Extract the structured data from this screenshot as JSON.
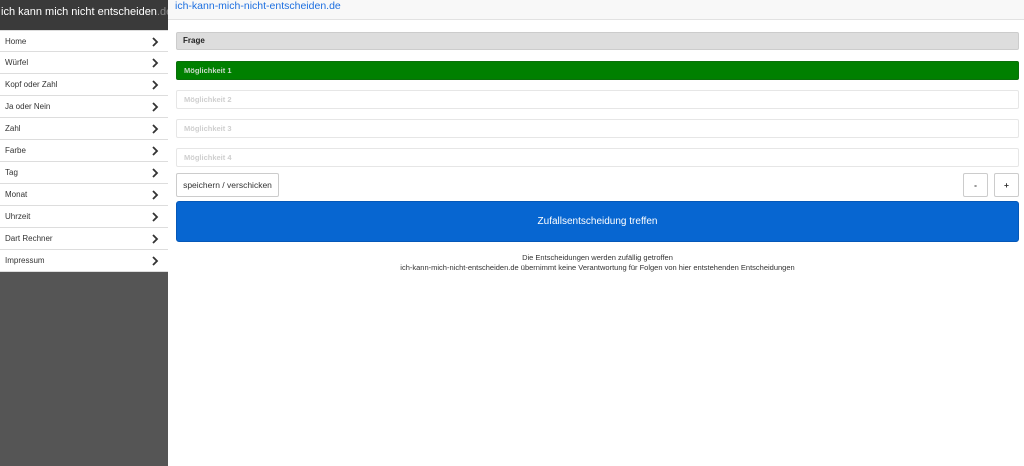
{
  "brand": {
    "name": "ich kann mich nicht entscheiden",
    "tld": ".de"
  },
  "topbar": {
    "site_link": "ich-kann-mich-nicht-entscheiden.de"
  },
  "sidebar": {
    "items": [
      {
        "label": "Home"
      },
      {
        "label": "Würfel"
      },
      {
        "label": "Kopf oder Zahl"
      },
      {
        "label": "Ja oder Nein"
      },
      {
        "label": "Zahl"
      },
      {
        "label": "Farbe"
      },
      {
        "label": "Tag"
      },
      {
        "label": "Monat"
      },
      {
        "label": "Uhrzeit"
      },
      {
        "label": "Dart Rechner"
      },
      {
        "label": "Impressum"
      }
    ]
  },
  "form": {
    "question_label": "Frage",
    "options": [
      "Möglichkeit 1",
      "Möglichkeit 2",
      "Möglichkeit 3",
      "Möglichkeit 4"
    ],
    "save_label": "speichern / verschicken",
    "minus_label": "-",
    "plus_label": "+",
    "decide_label": "Zufallsentscheidung treffen"
  },
  "notes": {
    "line1": "Die Entscheidungen werden zufällig getroffen",
    "line2": "ich-kann-mich-nicht-entscheiden.de übernimmt keine Verantwortung für Folgen von hier entstehenden Entscheidungen"
  },
  "colors": {
    "sidebar_bg": "#555555",
    "selected_option": "#008000",
    "primary_button": "#0766d1",
    "link": "#1d6fe0"
  }
}
